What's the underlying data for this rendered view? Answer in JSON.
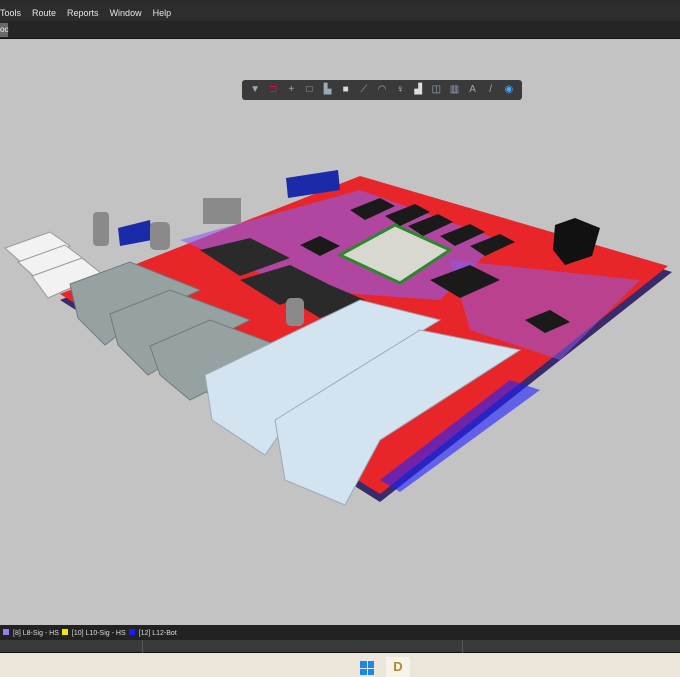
{
  "menu": [
    "Tools",
    "Route",
    "Reports",
    "Window",
    "Help"
  ],
  "tab": {
    "label": "oc"
  },
  "toolbar": {
    "icons": [
      "filter-icon",
      "interactive-route-icon",
      "crosshair-icon",
      "rectangle-select-icon",
      "place-component-icon",
      "place-3d-body-icon",
      "route-icon",
      "arc-icon",
      "via-icon",
      "polygon-icon",
      "region-icon",
      "dimension-icon",
      "text-icon",
      "line-icon",
      "view-3d-icon"
    ]
  },
  "layers": [
    {
      "label": "[8] L8-Sig - HS",
      "color": "#9b7cf0"
    },
    {
      "label": "[10] L10-Sig - HS",
      "color": "#f5e400"
    },
    {
      "label": "[12] L12-Bot",
      "color": "#1a1aff"
    }
  ],
  "colors": {
    "board": "#e8262a",
    "trace": "#8a5cf0",
    "connector": "#9aa7a6",
    "sfp": "#d3e3ef"
  }
}
